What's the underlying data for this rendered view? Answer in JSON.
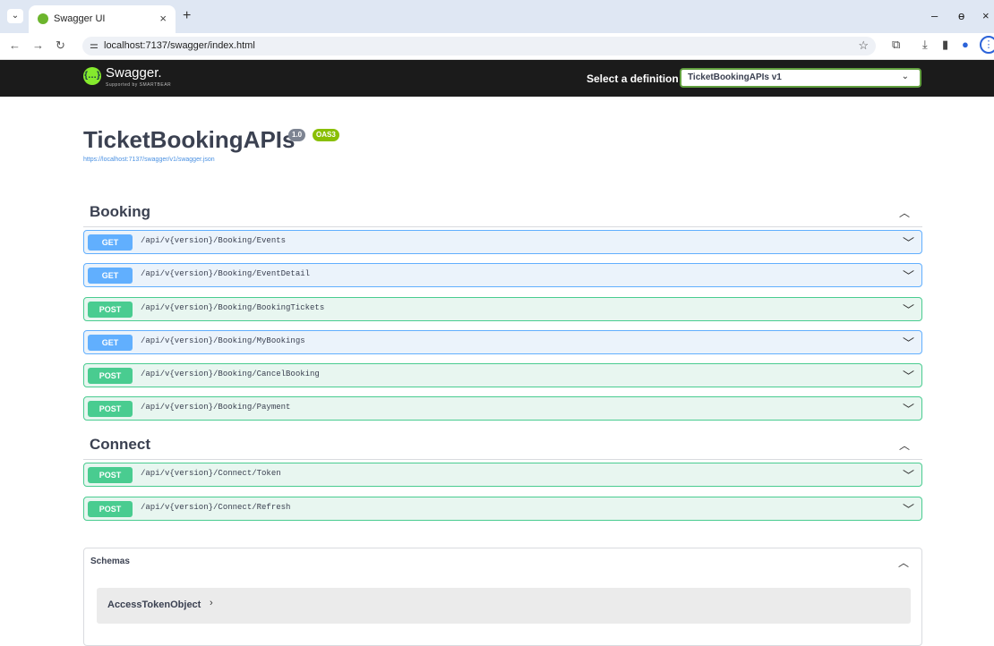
{
  "browser": {
    "tab_title": "Swagger UI",
    "url": "localhost:7137/swagger/index.html"
  },
  "topbar": {
    "logo_text": "Swagger.",
    "logo_sub": "Supported by SMARTBEAR",
    "definition_label": "Select a definition",
    "definition_value": "TicketBookingAPIs v1"
  },
  "info": {
    "title": "TicketBookingAPIs",
    "version": "1.0",
    "oas": "OAS3",
    "spec_url": "https://localhost:7137/swagger/v1/swagger.json"
  },
  "tags": [
    {
      "name": "Booking",
      "operations": [
        {
          "method": "GET",
          "path": "/api/v{version}/Booking/Events"
        },
        {
          "method": "GET",
          "path": "/api/v{version}/Booking/EventDetail"
        },
        {
          "method": "POST",
          "path": "/api/v{version}/Booking/BookingTickets"
        },
        {
          "method": "GET",
          "path": "/api/v{version}/Booking/MyBookings"
        },
        {
          "method": "POST",
          "path": "/api/v{version}/Booking/CancelBooking"
        },
        {
          "method": "POST",
          "path": "/api/v{version}/Booking/Payment"
        }
      ]
    },
    {
      "name": "Connect",
      "operations": [
        {
          "method": "POST",
          "path": "/api/v{version}/Connect/Token"
        },
        {
          "method": "POST",
          "path": "/api/v{version}/Connect/Refresh"
        }
      ]
    }
  ],
  "schemas": {
    "title": "Schemas",
    "items": [
      "AccessTokenObject"
    ]
  },
  "colors": {
    "get": "#61affe",
    "post": "#49cc90",
    "topbar": "#1b1b1b"
  }
}
